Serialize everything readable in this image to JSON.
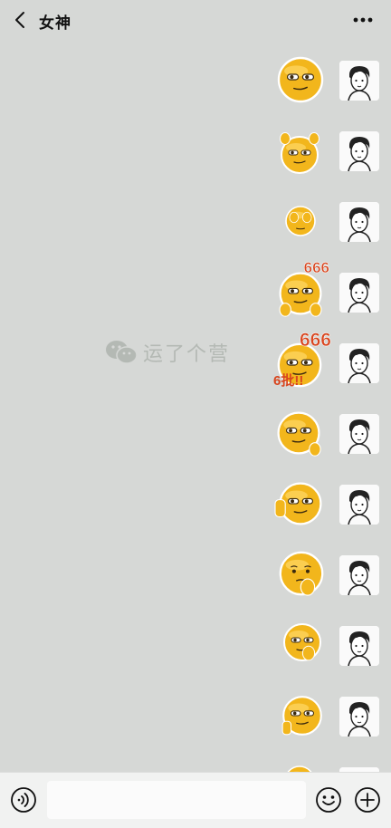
{
  "header": {
    "title": "女神",
    "back_icon": "chevron-left-icon",
    "more_icon": "more-dots-icon"
  },
  "watermark": {
    "text": "运了个营",
    "icon": "wechat-logo-icon"
  },
  "stickers": [
    {
      "name": "sticker-smirk-face",
      "icon": "smirk-emoji"
    },
    {
      "name": "sticker-hands-on-head",
      "icon": "hands-on-head-emoji"
    },
    {
      "name": "sticker-face-cover",
      "icon": "face-cover-emoji"
    },
    {
      "name": "sticker-666-thumbs",
      "icon": "thumbs-emoji",
      "caption": "666"
    },
    {
      "name": "sticker-666-niubi",
      "icon": "666-emoji",
      "caption": "666",
      "caption2": "6批!!"
    },
    {
      "name": "sticker-ok-hand",
      "icon": "ok-hand-emoji"
    },
    {
      "name": "sticker-wave-hand",
      "icon": "wave-emoji"
    },
    {
      "name": "sticker-pray-sad",
      "icon": "pray-emoji"
    },
    {
      "name": "sticker-pray-side",
      "icon": "pray-side-emoji"
    },
    {
      "name": "sticker-peace",
      "icon": "peace-emoji"
    },
    {
      "name": "sticker-partial",
      "icon": "smirk-emoji"
    }
  ],
  "input": {
    "value": "",
    "placeholder": ""
  },
  "colors": {
    "background": "#d6d8d6",
    "emoji_yellow": "#f2b61c",
    "caption_red": "#d8451e"
  }
}
